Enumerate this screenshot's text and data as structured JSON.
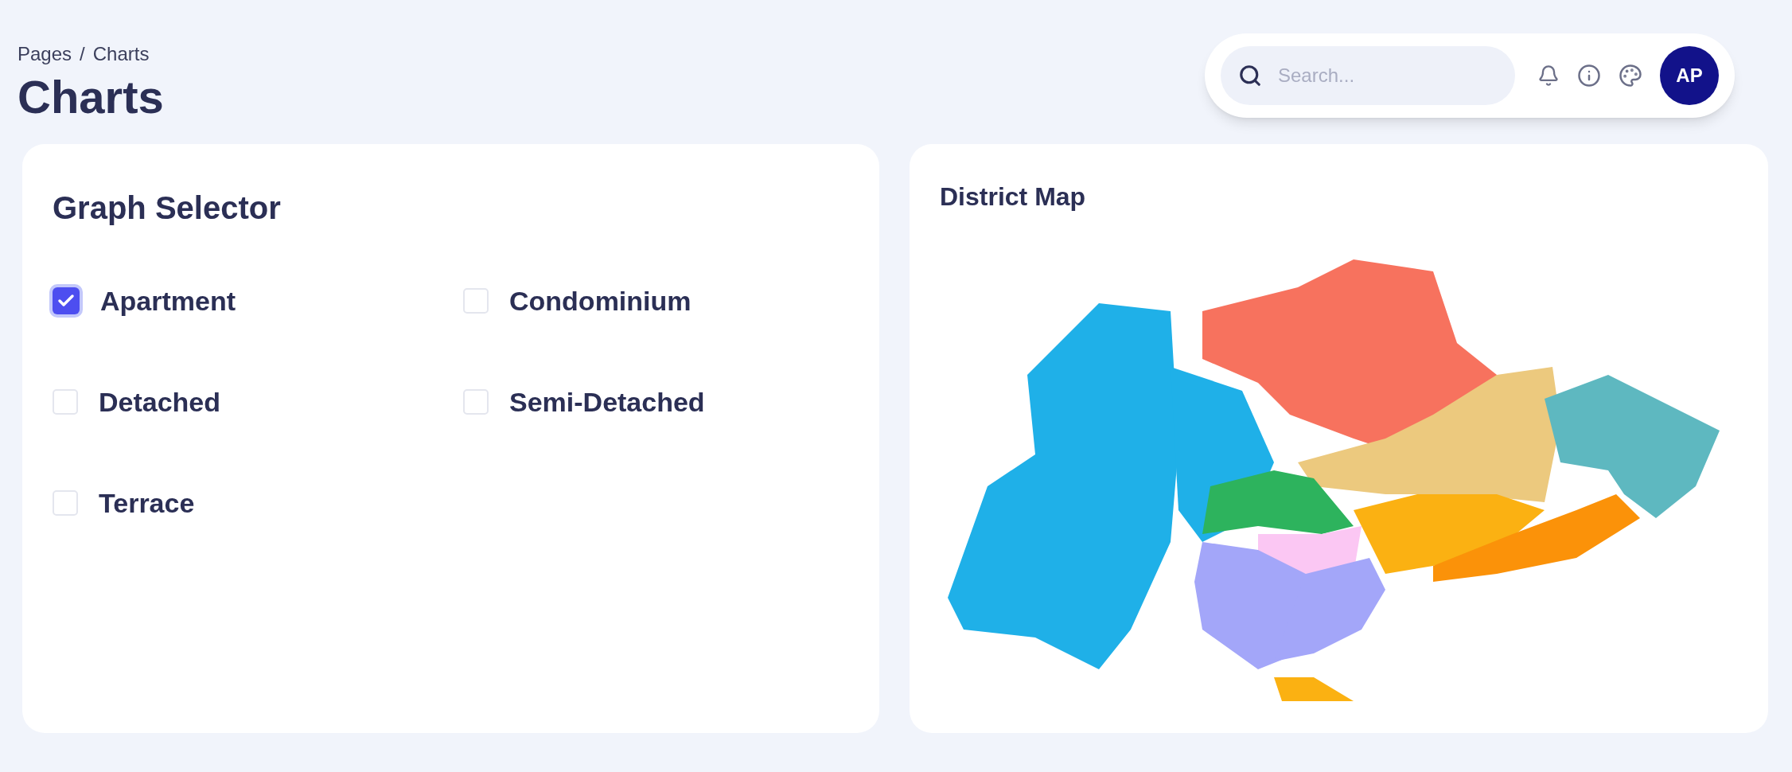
{
  "breadcrumbs": [
    "Pages",
    "/",
    "Charts"
  ],
  "page_title": "Charts",
  "search": {
    "placeholder": "Search..."
  },
  "avatar": {
    "initials": "AP"
  },
  "graph_selector": {
    "title": "Graph Selector",
    "options": [
      {
        "label": "Apartment",
        "checked": true
      },
      {
        "label": "Condominium",
        "checked": false
      },
      {
        "label": "Detached",
        "checked": false
      },
      {
        "label": "Semi-Detached",
        "checked": false
      },
      {
        "label": "Terrace",
        "checked": false
      }
    ]
  },
  "district_map": {
    "title": "District Map"
  }
}
